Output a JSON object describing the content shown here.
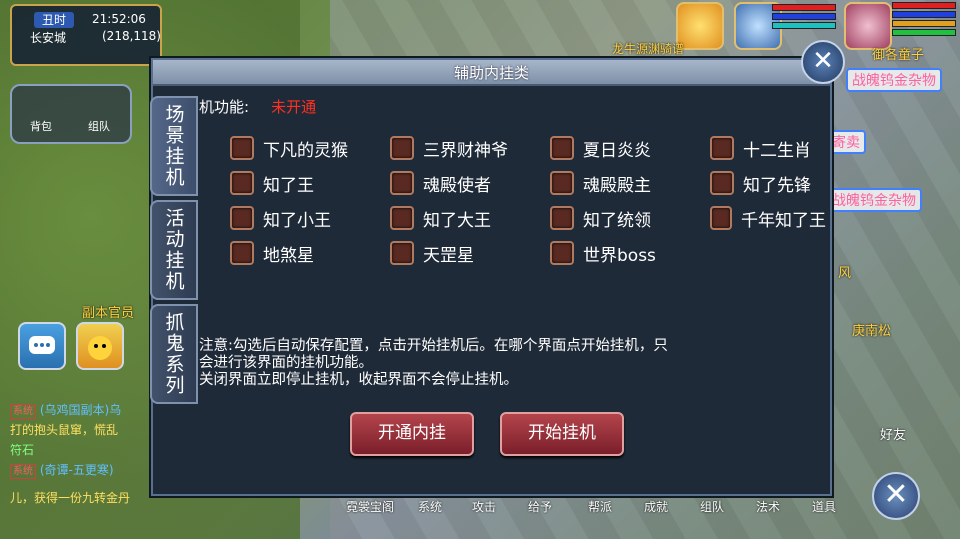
{
  "hud": {
    "shichen": "丑时",
    "time": "21:52:06",
    "city": "长安城",
    "coords": "(218,118)"
  },
  "left_menu": {
    "bag_label": "背包",
    "team_label": "组队"
  },
  "npc_labels": {
    "fuben": "副本官员",
    "gengnansong": "庚南松",
    "dragon": "龙牛源渊骑谱",
    "shop1": "战魄钨金杂物",
    "shop2": "战魄钨金杂物",
    "shop3": "寄卖",
    "leng": "御各童子",
    "fengzi": "风",
    "fuhao": "符石"
  },
  "chat": [
    {
      "tag": "系统",
      "text": "(乌鸡国副本)乌"
    },
    {
      "tag": "",
      "text": "打的抱头鼠窜，慌乱"
    },
    {
      "tag": "系统",
      "text": "(奇谭-五更寒)"
    },
    {
      "tag": "",
      "text": "儿，获得一份九转金丹"
    }
  ],
  "dialog": {
    "title": "辅助内挂类",
    "function_label": "机功能:",
    "function_status": "未开通",
    "tabs": [
      {
        "label": "场景挂机"
      },
      {
        "label": "活动挂机"
      },
      {
        "label": "抓鬼系列"
      }
    ],
    "options": [
      [
        "下凡的灵猴",
        "三界财神爷",
        "夏日炎炎",
        "十二生肖"
      ],
      [
        "知了王",
        "魂殿使者",
        "魂殿殿主",
        "知了先锋"
      ],
      [
        "知了小王",
        "知了大王",
        "知了统领",
        "千年知了王"
      ],
      [
        "地煞星",
        "天罡星",
        "世界boss"
      ]
    ],
    "notice_line1": "注意:勾选后自动保存配置，点击开始挂机后。在哪个界面点开始挂机，只",
    "notice_line2": "会进行该界面的挂机功能。",
    "notice_line3": "关闭界面立即停止挂机，收起界面不会停止挂机。",
    "btn_open": "开通内挂",
    "btn_start": "开始挂机"
  },
  "bottom_menu": [
    "霓裳宝阁",
    "系统",
    "攻击",
    "给予",
    "帮派",
    "成就",
    "组队",
    "法术",
    "道具"
  ],
  "friend_label": "好友",
  "colors": {
    "status_red": "#ff3020",
    "button_red": "#9a2f38",
    "checkbox": "#5a2a22"
  }
}
